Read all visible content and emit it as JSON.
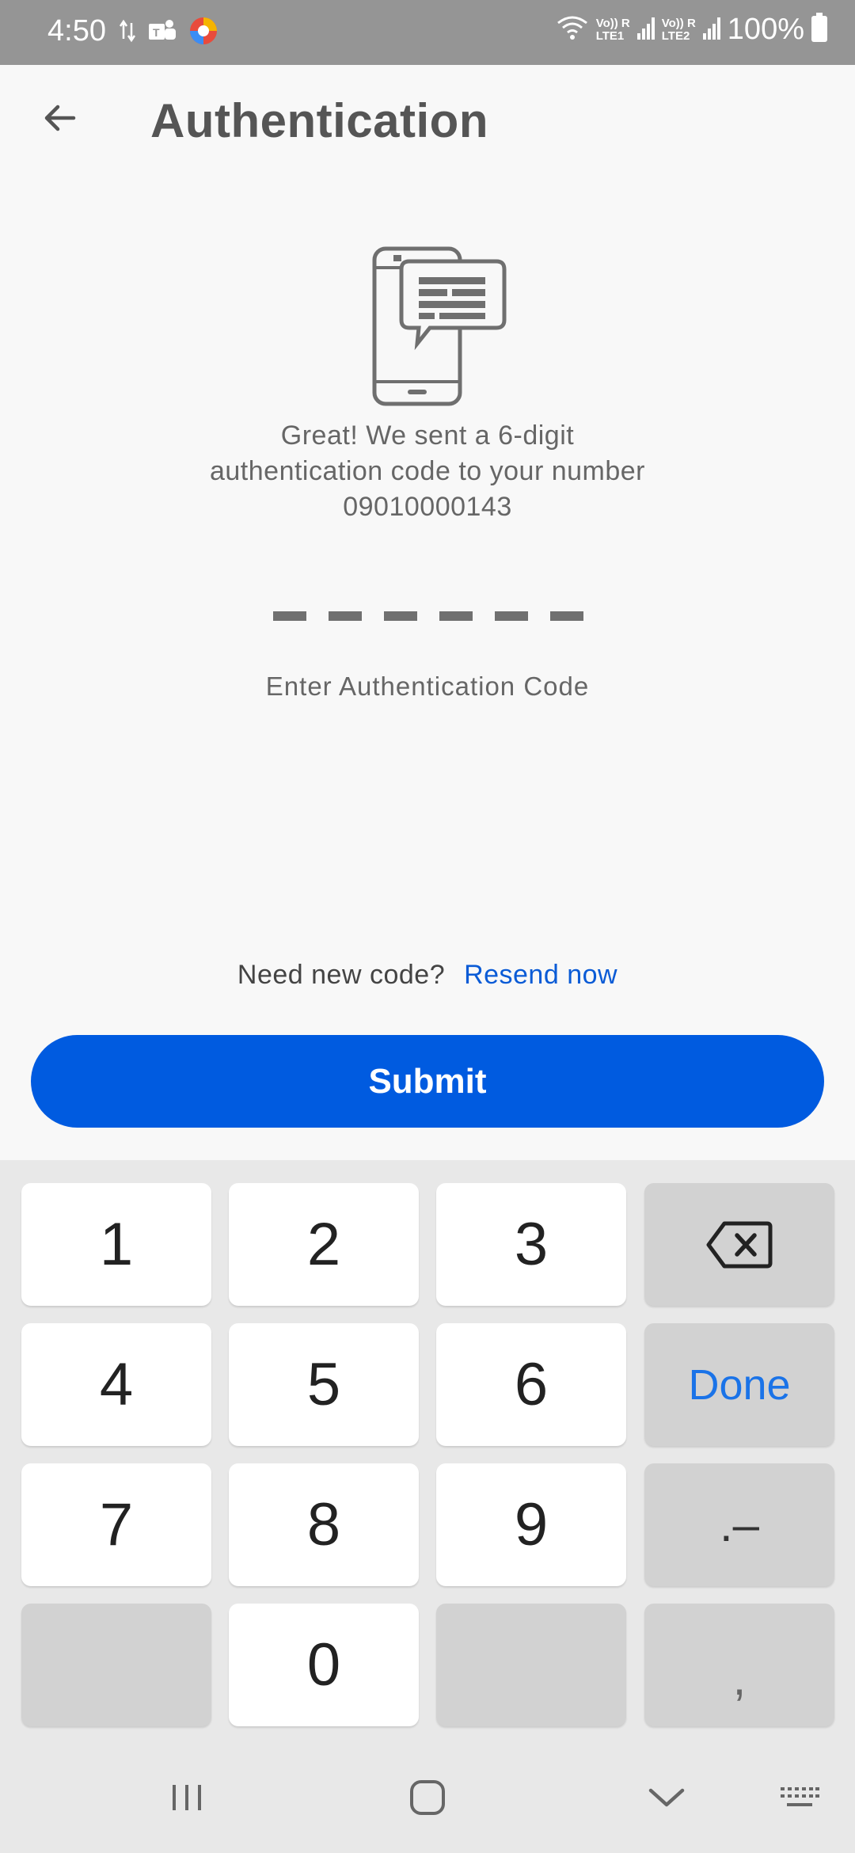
{
  "status_bar": {
    "time": "4:50",
    "battery": "100%",
    "sim1": {
      "top": "Vo)) R",
      "bottom": "LTE1"
    },
    "sim2": {
      "top": "Vo)) R",
      "bottom": "LTE2"
    },
    "icons": [
      "data-transfer-icon",
      "teams-icon",
      "app-circle-icon",
      "wifi-icon",
      "signal-icon",
      "battery-icon"
    ]
  },
  "header": {
    "title": "Authentication",
    "back_icon": "arrow-left-icon"
  },
  "main": {
    "illustration_icon": "phone-message-icon",
    "message_line1": "Great! We sent a 6-digit",
    "message_line2": "authentication code to your number",
    "phone_number": "09010000143",
    "code_length": 6,
    "code_label": "Enter Authentication Code",
    "resend_question": "Need new code?",
    "resend_link": "Resend now",
    "submit_label": "Submit"
  },
  "keyboard": {
    "keys": {
      "k1": "1",
      "k2": "2",
      "k3": "3",
      "k4": "4",
      "k5": "5",
      "k6": "6",
      "k7": "7",
      "k8": "8",
      "k9": "9",
      "k0": "0",
      "done": "Done",
      "dot_dash": ".–",
      "comma": ","
    },
    "backspace_icon": "backspace-icon"
  },
  "nav_bar": {
    "icons": [
      "recent-apps-icon",
      "home-icon",
      "back-chevron-icon",
      "keyboard-switch-icon"
    ]
  },
  "colors": {
    "accent": "#005be0",
    "link": "#0a5bd6",
    "status_bar": "#959595",
    "done_key": "#1a73e8"
  }
}
